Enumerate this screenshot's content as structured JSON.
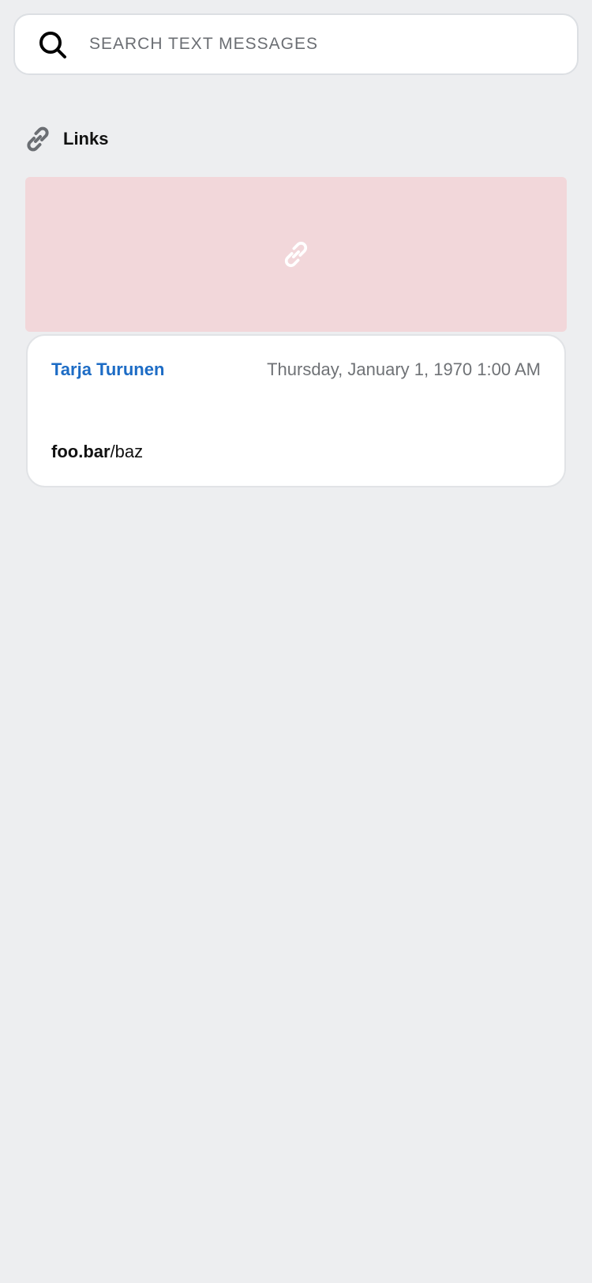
{
  "search": {
    "placeholder": "SEARCH TEXT MESSAGES",
    "icon": "search-icon"
  },
  "section": {
    "title": "Links",
    "icon": "link-icon"
  },
  "link_preview": {
    "background_color": "#f2d7da",
    "icon": "link-icon"
  },
  "message": {
    "sender": "Tarja Turunen",
    "timestamp": "Thursday, January 1, 1970 1:00 AM",
    "link_domain": "foo.bar",
    "link_path": "/baz"
  },
  "colors": {
    "background": "#edeef0",
    "accent": "#1d6cc5"
  }
}
